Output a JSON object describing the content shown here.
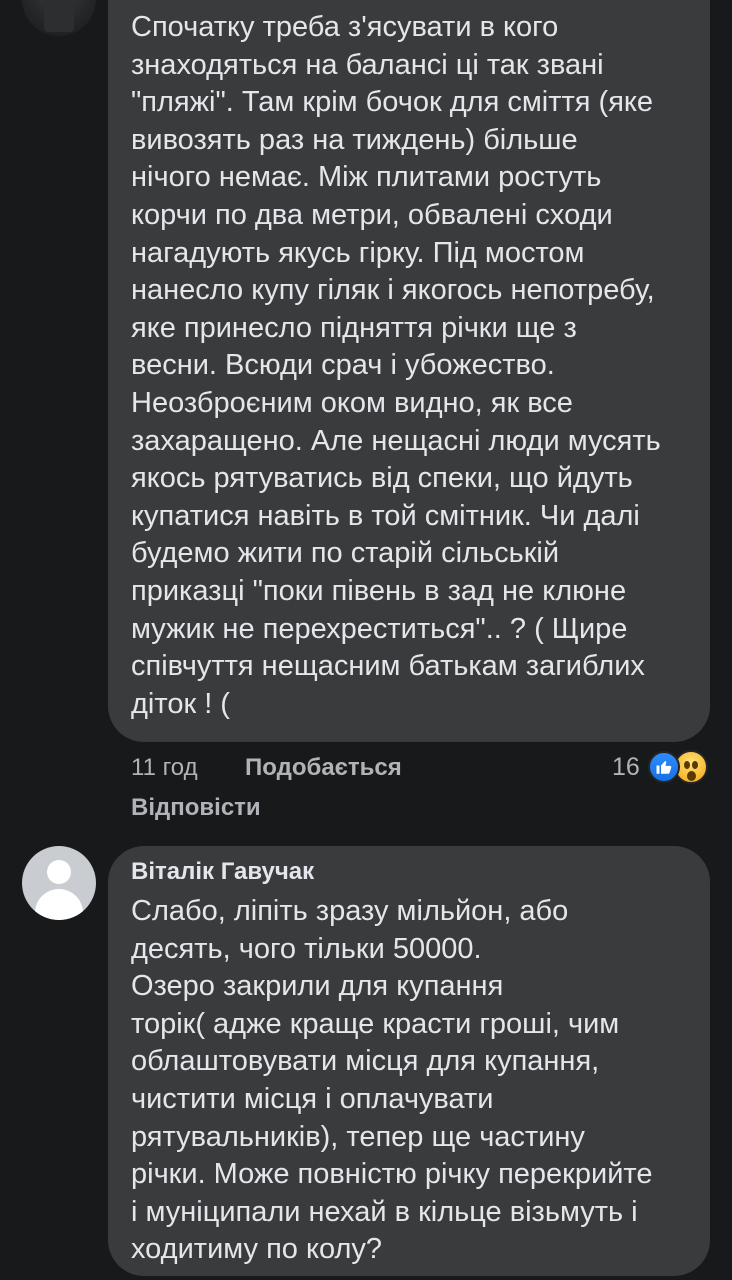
{
  "comment_1": {
    "text": "Спочатку треба з'ясувати в кого\nзнаходяться на балансі ці так звані\n\"пляжі\". Там крім бочок для сміття (яке\nвивозять раз на тиждень) більше\nнічого немає. Між плитами ростуть\nкорчи по два метри, обвалені сходи\nнагадують якусь гірку. Під мостом\nнанесло купу гіляк і якогось непотребу,\nяке принесло підняття річки ще з\nвесни. Всюди срач і убожество.\nНеозброєним оком видно, як все\nзахаращено. Але нещасні люди мусять\nякось рятуватись від спеки, що йдуть\nкупатися навіть в той смітник. Чи далі\nбудемо жити по старій сільській\nприказці \"поки півень в зад не клюне\nмужик не перехреститься\".. ? ( Щире\nспівчуття нещасним батькам загиблих\nдіток ! (",
    "time": "11 год",
    "like_label": "Подобається",
    "reply_label": "Відповісти",
    "reaction_count": "16",
    "reactions": [
      "like-icon",
      "wow-icon"
    ]
  },
  "comment_2": {
    "author": "Віталік Гавучак",
    "text": "Слабо, ліпіть зразу мільйон, або\nдесять, чого тільки 50000.\nОзеро закрили для купання\nторік( адже краще красти гроші, чим\nоблаштовувати місця для купання,\nчистити місця і оплачувати\nрятувальників), тепер ще частину\nрічки. Може повністю річку перекрийте\nі муніципали нехай в кільце візьмуть і\nходитиму по колу?"
  },
  "colors": {
    "background": "#18191a",
    "bubble": "#3a3b3c",
    "primary_text": "#e4e6eb",
    "secondary_text": "#b0b3b8",
    "like_blue": "#1877f2"
  }
}
